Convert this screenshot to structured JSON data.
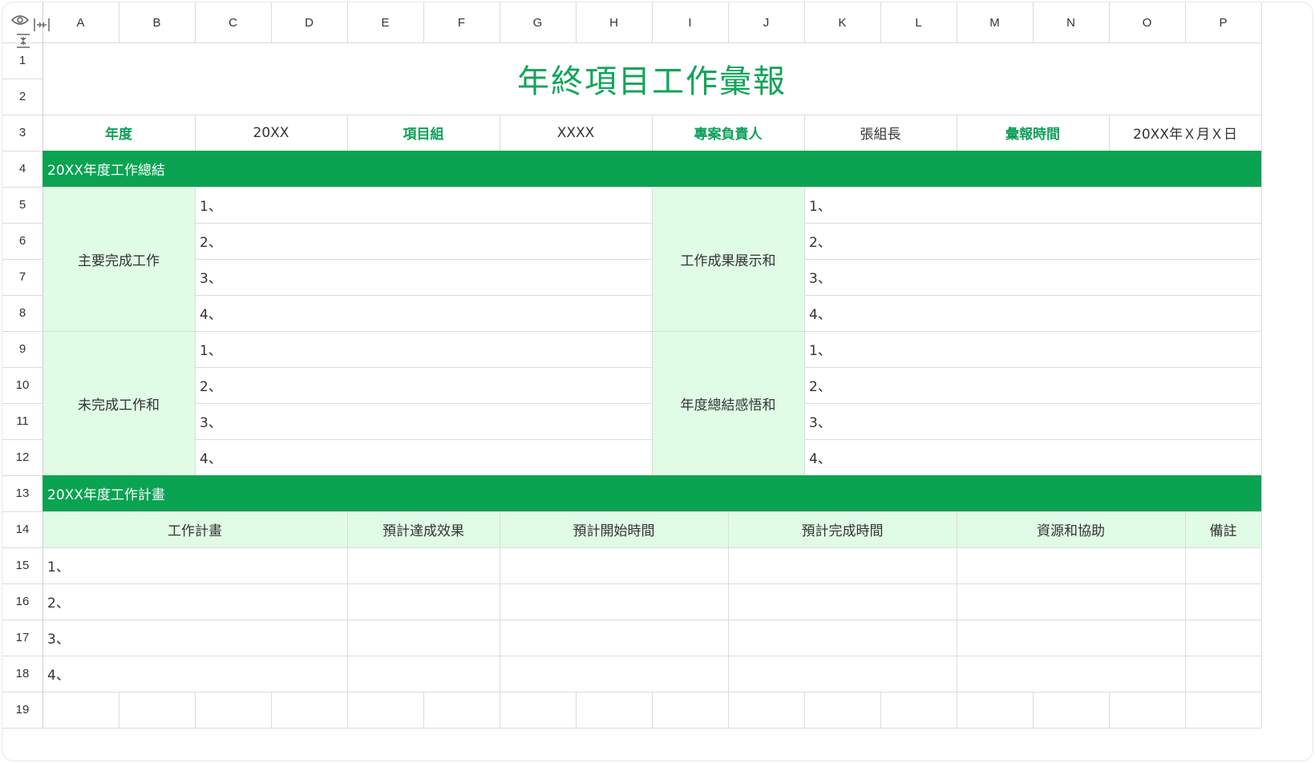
{
  "columns": [
    "A",
    "B",
    "C",
    "D",
    "E",
    "F",
    "G",
    "H",
    "I",
    "J",
    "K",
    "L",
    "M",
    "N",
    "O",
    "P"
  ],
  "rows": [
    "1",
    "2",
    "3",
    "4",
    "5",
    "6",
    "7",
    "8",
    "9",
    "10",
    "11",
    "12",
    "13",
    "14",
    "15",
    "16",
    "17",
    "18",
    "19"
  ],
  "title": "年終項目工作彙報",
  "info": {
    "year_label": "年度",
    "year_value": "20XX",
    "group_label": "項目組",
    "group_value": "XXXX",
    "owner_label": "專案負責人",
    "owner_value": "張組長",
    "report_time_label": "彙報時間",
    "report_time_value": "20XX年Ｘ月Ｘ日"
  },
  "summary_bar": "20XX年度工作總結",
  "summary": {
    "main_work_label": "主要完成工作",
    "main_work_items": [
      "1、",
      "2、",
      "3、",
      "4、"
    ],
    "results_label": "工作成果展示和",
    "results_items": [
      "1、",
      "2、",
      "3、",
      "4、"
    ],
    "unfinished_label": "未完成工作和",
    "unfinished_items": [
      "1、",
      "2、",
      "3、",
      "4、"
    ],
    "reflection_label": "年度總結感悟和",
    "reflection_items": [
      "1、",
      "2、",
      "3、",
      "4、"
    ]
  },
  "plan_bar": "20XX年度工作計畫",
  "plan_headers": [
    "工作計畫",
    "預計達成效果",
    "預計開始時間",
    "預計完成時間",
    "資源和協助",
    "備註"
  ],
  "plan_items": [
    "1、",
    "2、",
    "3、",
    "4、"
  ],
  "colors": {
    "accent": "#0aa352",
    "light_green": "#e0fbe6",
    "title_green": "#10a558"
  },
  "icons": {
    "corner": [
      "eye-icon",
      "collapse-columns-icon",
      "collapse-rows-icon"
    ]
  }
}
